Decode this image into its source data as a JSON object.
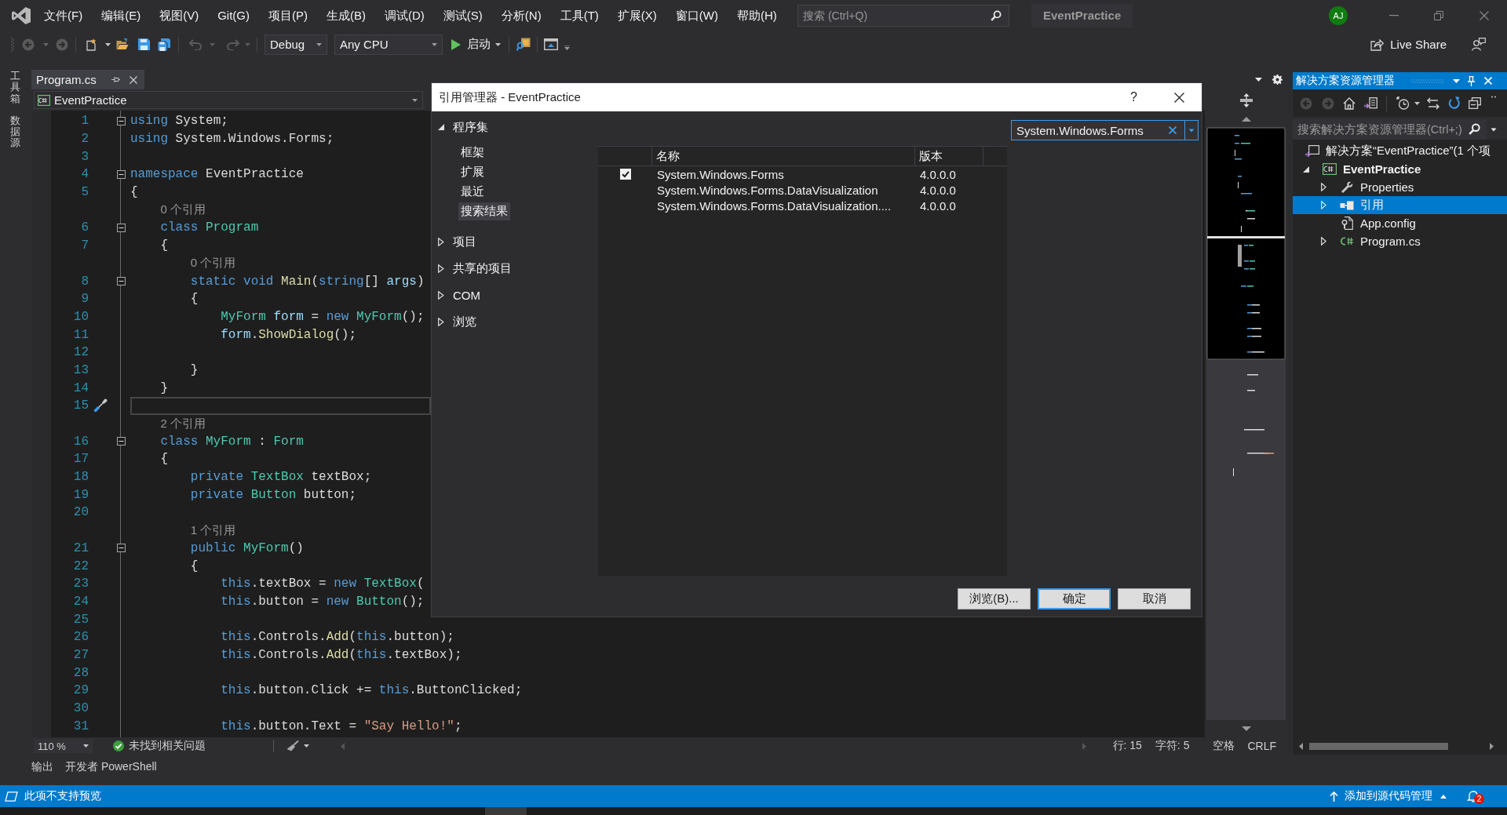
{
  "title_bar": {
    "menus": [
      "文件(F)",
      "编辑(E)",
      "视图(V)",
      "Git(G)",
      "项目(P)",
      "生成(B)",
      "调试(D)",
      "测试(S)",
      "分析(N)",
      "工具(T)",
      "扩展(X)",
      "窗口(W)",
      "帮助(H)"
    ],
    "search": {
      "placeholder": "搜索 (Ctrl+Q)"
    },
    "solution_name": "EventPractice",
    "account_initials": "AJ"
  },
  "toolbar": {
    "configuration": "Debug",
    "platform": "Any CPU",
    "start": "启动",
    "live_share": "Live Share"
  },
  "side_tabs": [
    "工具箱",
    "数据源"
  ],
  "editor": {
    "tab": {
      "label": "Program.cs",
      "selected": true
    },
    "navigation": "EventPractice",
    "lines": [
      {
        "kind": "code",
        "number": "1",
        "expanded": true,
        "current": false,
        "tokens": [
          {
            "kind": "keyword",
            "text": "using"
          },
          {
            "kind": "plain",
            "text": " System;"
          }
        ]
      },
      {
        "kind": "code",
        "number": "2",
        "current": false,
        "tokens": [
          {
            "kind": "keyword",
            "text": "using"
          },
          {
            "kind": "plain",
            "text": " System.Windows.Forms;"
          }
        ]
      },
      {
        "kind": "code",
        "number": "3",
        "current": false
      },
      {
        "kind": "code",
        "number": "4",
        "expanded": true,
        "current": false,
        "tokens": [
          {
            "kind": "keyword",
            "text": "namespace"
          },
          {
            "kind": "plain",
            "text": " EventPractice"
          }
        ]
      },
      {
        "kind": "code",
        "number": "5",
        "current": false,
        "tokens": [
          {
            "kind": "plain",
            "text": "{"
          }
        ]
      },
      {
        "kind": "lens",
        "text": "0 个引用"
      },
      {
        "kind": "code",
        "number": "6",
        "expanded": true,
        "current": false,
        "tokens": [
          {
            "kind": "keyword",
            "text": "    class "
          },
          {
            "kind": "type",
            "text": "Program"
          }
        ]
      },
      {
        "kind": "code",
        "number": "7",
        "current": false,
        "tokens": [
          {
            "kind": "plain",
            "text": "    {"
          }
        ]
      },
      {
        "kind": "lens",
        "text": "0 个引用"
      },
      {
        "kind": "code",
        "number": "8",
        "expanded": true,
        "current": false,
        "tokens": [
          {
            "kind": "keyword",
            "text": "        static void "
          },
          {
            "kind": "method",
            "text": "Main"
          },
          {
            "kind": "plain",
            "text": "("
          },
          {
            "kind": "keyword",
            "text": "string"
          },
          {
            "kind": "plain",
            "text": "[] "
          },
          {
            "kind": "variable",
            "text": "args"
          },
          {
            "kind": "plain",
            "text": ")"
          }
        ]
      },
      {
        "kind": "code",
        "number": "9",
        "current": false,
        "tokens": [
          {
            "kind": "plain",
            "text": "        {"
          }
        ]
      },
      {
        "kind": "code",
        "number": "10",
        "current": false,
        "tokens": [
          {
            "kind": "type",
            "text": "            MyForm "
          },
          {
            "kind": "variable",
            "text": "form"
          },
          {
            "kind": "plain",
            "text": " = "
          },
          {
            "kind": "keyword",
            "text": "new "
          },
          {
            "kind": "type",
            "text": "MyForm"
          },
          {
            "kind": "plain",
            "text": "();"
          }
        ]
      },
      {
        "kind": "code",
        "number": "11",
        "current": false,
        "tokens": [
          {
            "kind": "variable",
            "text": "            form"
          },
          {
            "kind": "plain",
            "text": "."
          },
          {
            "kind": "method",
            "text": "ShowDialog"
          },
          {
            "kind": "plain",
            "text": "();"
          }
        ]
      },
      {
        "kind": "code",
        "number": "12",
        "current": false
      },
      {
        "kind": "code",
        "number": "13",
        "current": false,
        "tokens": [
          {
            "kind": "plain",
            "text": "        }"
          }
        ]
      },
      {
        "kind": "code",
        "number": "14",
        "current": false,
        "tokens": [
          {
            "kind": "plain",
            "text": "    }"
          }
        ]
      },
      {
        "kind": "code",
        "number": "15",
        "current": true
      },
      {
        "kind": "lens",
        "text": "2 个引用"
      },
      {
        "kind": "code",
        "number": "16",
        "expanded": true,
        "current": false,
        "tokens": [
          {
            "kind": "keyword",
            "text": "    class "
          },
          {
            "kind": "type",
            "text": "MyForm"
          },
          {
            "kind": "plain",
            "text": " : "
          },
          {
            "kind": "type",
            "text": "Form"
          }
        ]
      },
      {
        "kind": "code",
        "number": "17",
        "current": false,
        "tokens": [
          {
            "kind": "plain",
            "text": "    {"
          }
        ]
      },
      {
        "kind": "code",
        "number": "18",
        "current": false,
        "tokens": [
          {
            "kind": "keyword",
            "text": "        private "
          },
          {
            "kind": "type",
            "text": "TextBox"
          },
          {
            "kind": "plain",
            "text": " textBox;"
          }
        ]
      },
      {
        "kind": "code",
        "number": "19",
        "current": false,
        "tokens": [
          {
            "kind": "keyword",
            "text": "        private "
          },
          {
            "kind": "type",
            "text": "Button"
          },
          {
            "kind": "plain",
            "text": " button;"
          }
        ]
      },
      {
        "kind": "code",
        "number": "20",
        "current": false
      },
      {
        "kind": "lens",
        "text": "1 个引用"
      },
      {
        "kind": "code",
        "number": "21",
        "expanded": true,
        "current": false,
        "tokens": [
          {
            "kind": "keyword",
            "text": "        public "
          },
          {
            "kind": "type",
            "text": "MyForm"
          },
          {
            "kind": "plain",
            "text": "()"
          }
        ]
      },
      {
        "kind": "code",
        "number": "22",
        "current": false,
        "tokens": [
          {
            "kind": "plain",
            "text": "        {"
          }
        ]
      },
      {
        "kind": "code",
        "number": "23",
        "current": false,
        "tokens": [
          {
            "kind": "keyword",
            "text": "            this"
          },
          {
            "kind": "plain",
            "text": ".textBox = "
          },
          {
            "kind": "keyword",
            "text": "new "
          },
          {
            "kind": "type",
            "text": "TextBox"
          },
          {
            "kind": "plain",
            "text": "("
          }
        ]
      },
      {
        "kind": "code",
        "number": "24",
        "current": false,
        "tokens": [
          {
            "kind": "keyword",
            "text": "            this"
          },
          {
            "kind": "plain",
            "text": ".button = "
          },
          {
            "kind": "keyword",
            "text": "new "
          },
          {
            "kind": "type",
            "text": "Button"
          },
          {
            "kind": "plain",
            "text": "();"
          }
        ]
      },
      {
        "kind": "code",
        "number": "25",
        "current": false
      },
      {
        "kind": "code",
        "number": "26",
        "current": false,
        "tokens": [
          {
            "kind": "keyword",
            "text": "            this"
          },
          {
            "kind": "plain",
            "text": ".Controls."
          },
          {
            "kind": "method",
            "text": "Add"
          },
          {
            "kind": "plain",
            "text": "("
          },
          {
            "kind": "keyword",
            "text": "this"
          },
          {
            "kind": "plain",
            "text": ".button);"
          }
        ]
      },
      {
        "kind": "code",
        "number": "27",
        "current": false,
        "tokens": [
          {
            "kind": "keyword",
            "text": "            this"
          },
          {
            "kind": "plain",
            "text": ".Controls."
          },
          {
            "kind": "method",
            "text": "Add"
          },
          {
            "kind": "plain",
            "text": "("
          },
          {
            "kind": "keyword",
            "text": "this"
          },
          {
            "kind": "plain",
            "text": ".textBox);"
          }
        ]
      },
      {
        "kind": "code",
        "number": "28",
        "current": false
      },
      {
        "kind": "code",
        "number": "29",
        "current": false,
        "tokens": [
          {
            "kind": "keyword",
            "text": "            this"
          },
          {
            "kind": "plain",
            "text": ".button.Click += "
          },
          {
            "kind": "keyword",
            "text": "this"
          },
          {
            "kind": "plain",
            "text": ".ButtonClicked;"
          }
        ]
      },
      {
        "kind": "code",
        "number": "30",
        "current": false
      },
      {
        "kind": "code",
        "number": "31",
        "current": false,
        "tokens": [
          {
            "kind": "keyword",
            "text": "            this"
          },
          {
            "kind": "plain",
            "text": ".button.Text = "
          },
          {
            "kind": "string",
            "text": "\"Say Hello!\""
          },
          {
            "kind": "plain",
            "text": ";"
          }
        ]
      }
    ],
    "zoom": "110 %",
    "issues": "未找到相关问题",
    "caret_line": "行: 15",
    "caret_column": "字符: 5",
    "whitespace": "空格",
    "line_ending": "CRLF"
  },
  "output_tabs": [
    "输出",
    "开发者 PowerShell"
  ],
  "dialog": {
    "title": "引用管理器 - EventPractice",
    "help": "?",
    "nav": [
      {
        "label": "程序集",
        "expanded": true,
        "selected": false,
        "children": [
          {
            "label": "框架",
            "selected": false
          },
          {
            "label": "扩展",
            "selected": false
          },
          {
            "label": "最近",
            "selected": false
          },
          {
            "label": "搜索结果",
            "selected": true
          }
        ]
      },
      {
        "label": "项目",
        "expanded": false,
        "selected": false
      },
      {
        "label": "共享的项目",
        "expanded": false,
        "selected": false
      },
      {
        "label": "COM",
        "expanded": false,
        "selected": false
      },
      {
        "label": "浏览",
        "expanded": false,
        "selected": false
      }
    ],
    "search": {
      "value": "System.Windows.Forms"
    },
    "columns": [
      "名称",
      "版本"
    ],
    "rows": [
      {
        "checked": true,
        "name": "System.Windows.Forms",
        "version": "4.0.0.0"
      },
      {
        "checked": false,
        "name": "System.Windows.Forms.DataVisualization",
        "version": "4.0.0.0"
      },
      {
        "checked": false,
        "name": "System.Windows.Forms.DataVisualization....",
        "version": "4.0.0.0"
      }
    ],
    "buttons": [
      {
        "label": "浏览(B)...",
        "default": false
      },
      {
        "label": "确定",
        "default": true
      },
      {
        "label": "取消",
        "default": false
      }
    ]
  },
  "solution_explorer": {
    "title": "解决方案资源管理器",
    "search": {
      "placeholder": "搜索解决方案资源管理器(Ctrl+;)"
    },
    "tree": [
      {
        "kind": "solution",
        "label": "解决方案“EventPractice”(1 个项",
        "selected": false,
        "children": [
          {
            "kind": "project",
            "label": "EventPractice",
            "expanded": true,
            "selected": false,
            "children": [
              {
                "kind": "properties",
                "label": "Properties",
                "expanded": false,
                "selected": false
              },
              {
                "kind": "references",
                "label": "引用",
                "expanded": false,
                "selected": true
              },
              {
                "kind": "config",
                "label": "App.config",
                "selected": false
              },
              {
                "kind": "csharp",
                "label": "Program.cs",
                "expanded": false,
                "selected": false
              }
            ]
          }
        ]
      }
    ]
  },
  "status_bar": {
    "message": "此项不支持预览",
    "source_control": "添加到源代码管理",
    "notification_count": "2"
  }
}
